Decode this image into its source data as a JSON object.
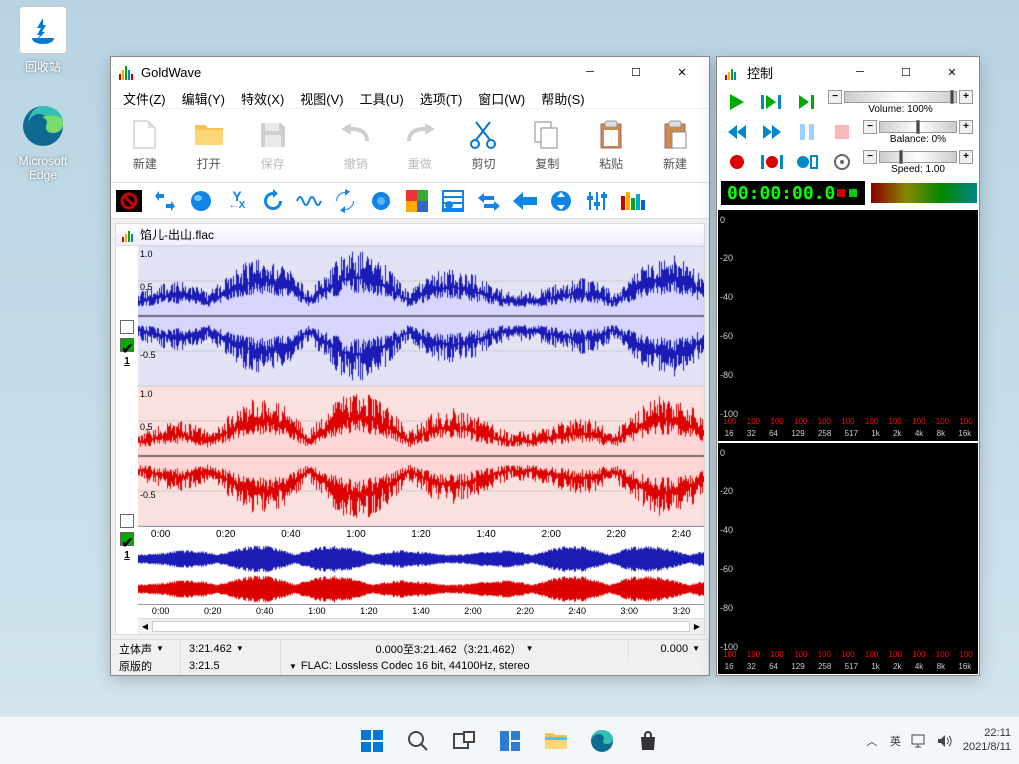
{
  "desktop": {
    "recycle_bin_label": "回收站",
    "edge_label": "Microsoft Edge"
  },
  "main_window": {
    "title": "GoldWave",
    "menus": [
      "文件(Z)",
      "编辑(Y)",
      "特效(X)",
      "视图(V)",
      "工具(U)",
      "选项(T)",
      "窗口(W)",
      "帮助(S)"
    ],
    "toolbar1": [
      {
        "label": "新建",
        "icon": "file"
      },
      {
        "label": "打开",
        "icon": "folder"
      },
      {
        "label": "保存",
        "icon": "save",
        "disabled": true
      },
      {
        "label": "撤销",
        "icon": "undo",
        "disabled": true
      },
      {
        "label": "重做",
        "icon": "redo",
        "disabled": true
      },
      {
        "label": "剪切",
        "icon": "cut"
      },
      {
        "label": "复制",
        "icon": "copy"
      },
      {
        "label": "粘贴",
        "icon": "paste"
      },
      {
        "label": "新建",
        "icon": "paste-new"
      }
    ],
    "document_title": "馅儿-出山.flac",
    "yaxis": [
      "1.0",
      "0.5",
      "-0.5"
    ],
    "ruler_main": [
      "0:00",
      "0:20",
      "0:40",
      "1:00",
      "1:20",
      "1:40",
      "2:00",
      "2:20",
      "2:40"
    ],
    "ruler_mini": [
      "0:00",
      "0:20",
      "0:40",
      "1:00",
      "1:20",
      "1:40",
      "2:00",
      "2:20",
      "2:40",
      "3:00",
      "3:20"
    ],
    "status": {
      "mode": "立体声",
      "length": "3:21.462",
      "selection": "0.000至3:21.462（3:21.462）",
      "cursor": "0.000",
      "license": "原版的",
      "total": "3:21.5",
      "codec": "FLAC: Lossless Codec 16 bit, 44100Hz, stereo"
    }
  },
  "control_window": {
    "title": "控制",
    "volume_label": "Volume: 100%",
    "balance_label": "Balance: 0%",
    "speed_label": "Speed: 1.00",
    "time": "00:00:00.0",
    "db_labels": [
      "0",
      "-20",
      "-40",
      "-60",
      "-80",
      "-100"
    ],
    "red_vals": [
      "100",
      "100",
      "100",
      "100",
      "100",
      "100",
      "100",
      "100",
      "100",
      "100",
      "100"
    ],
    "freq_labels": [
      "16",
      "32",
      "64",
      "129",
      "258",
      "517",
      "1k",
      "2k",
      "4k",
      "8k",
      "16k"
    ]
  },
  "taskbar": {
    "ime_up": "英",
    "ime_full": "英",
    "time": "22:11",
    "date": "2021/8/11"
  }
}
